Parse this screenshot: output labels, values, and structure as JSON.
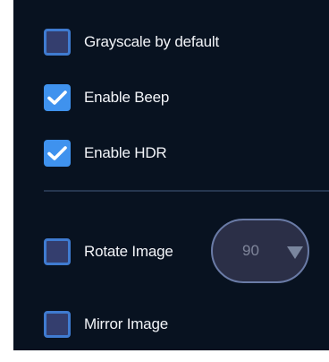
{
  "options": [
    {
      "label": "Grayscale by default",
      "checked": false
    },
    {
      "label": "Enable Beep",
      "checked": true
    },
    {
      "label": "Enable HDR",
      "checked": true
    },
    {
      "label": "Rotate Image",
      "checked": false
    },
    {
      "label": "Mirror Image",
      "checked": false
    }
  ],
  "rotate_select": {
    "value": "90"
  },
  "colors": {
    "panel_bg": "#081220",
    "checkbox_checked": "#3f92ee",
    "checkbox_unchecked": "#343e6e",
    "checkbox_border": "#3f7bd0",
    "label_text": "#f2f4f8",
    "select_text": "#7f859a"
  }
}
